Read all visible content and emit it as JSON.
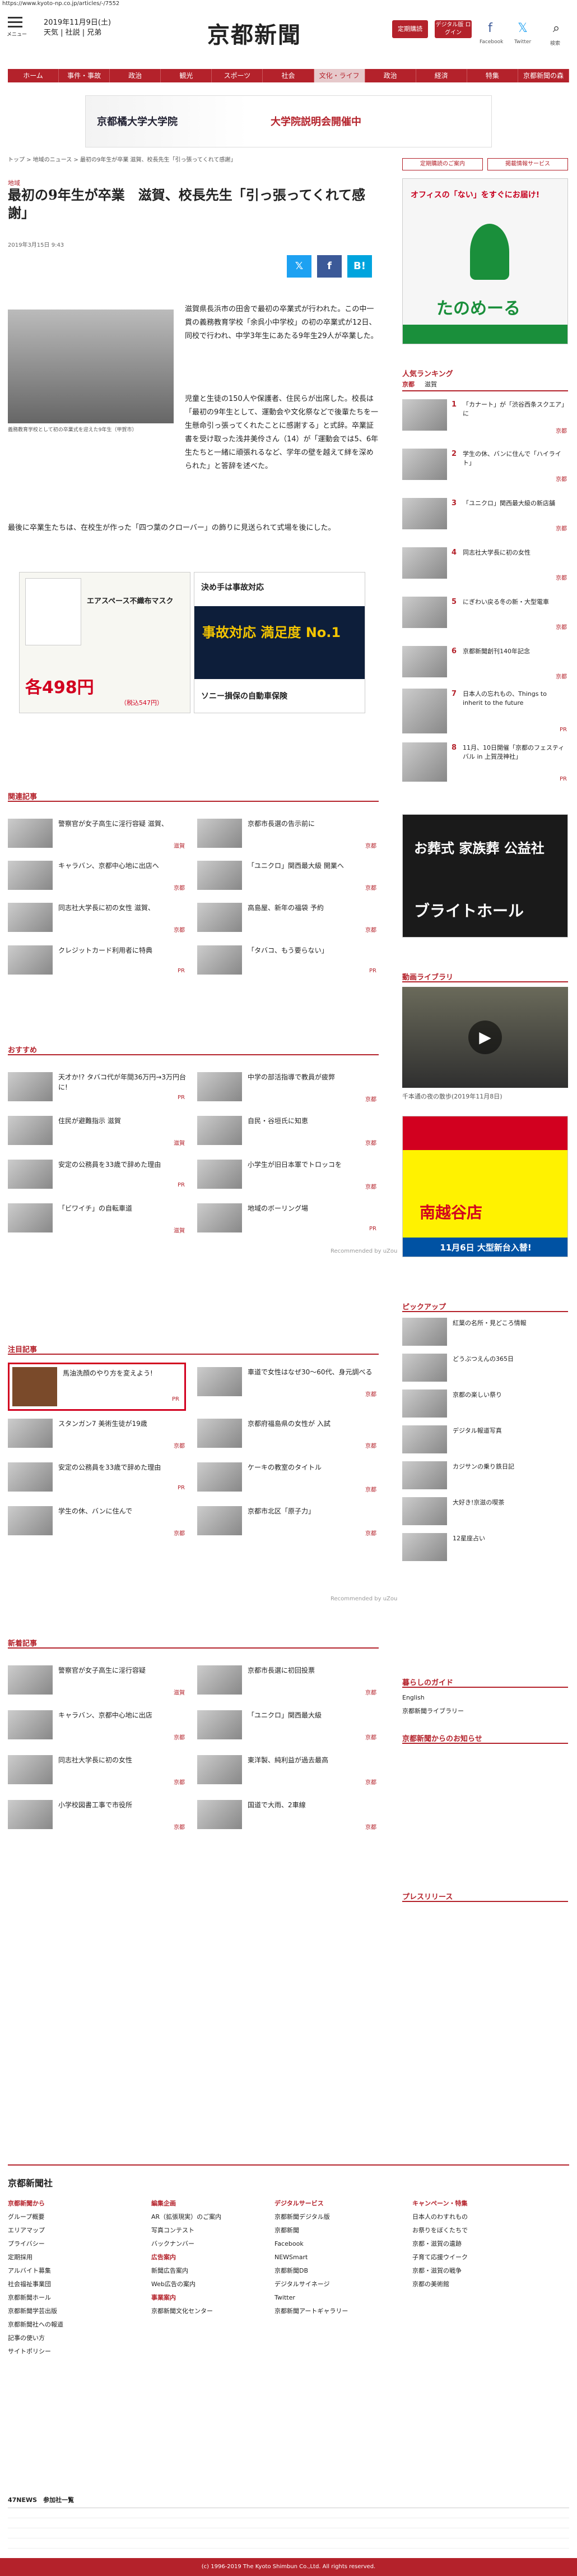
{
  "url": "https://www.kyoto-np.co.jp/articles/-/7552",
  "header": {
    "menu_label": "メニュー",
    "date": "2019年11月9日(土)",
    "weather_line": "天気 | 社説 | 兄弟",
    "logo": "京都新聞",
    "btn_subscribe": "定期購読",
    "btn_digital": "デジタル版 ログイン",
    "facebook": "Facebook",
    "twitter": "Twitter",
    "search": "検索"
  },
  "nav": [
    "ホーム",
    "事件・事故",
    "政治",
    "観光",
    "スポーツ",
    "社会",
    "文化・ライフ",
    "政治",
    "経済",
    "特集",
    "京都新聞の森"
  ],
  "banner": {
    "left": "京都橘大学大学院",
    "right": "大学院説明会開催中"
  },
  "breadcrumb": "トップ > 地域のニュース > 最初の9年生が卒業 滋賀、校長先生「引っ張ってくれて感謝」",
  "article": {
    "tag": "地域",
    "title": "最初の9年生が卒業　滋賀、校長先生「引っ張ってくれて感謝」",
    "date": "2019年3月15日 9:43",
    "photo_caption": "義務教育学校として初の卒業式を迎えた9年生（甲賀市）",
    "p1": "滋賀県長浜市の田舎で最初の卒業式が行われた。この中一貫の義務教育学校「余呉小中学校」の初の卒業式が12日、同校で行われ、中学3年生にあたる9年生29人が卒業した。",
    "p2": "児童と生徒の150人や保護者、住民らが出席した。校長は「最初の9年生として、運動会や文化祭などで後輩たちを一生懸命引っ張ってくれたことに感謝する」と式辞。卒業証書を受け取った浅井美伶さん（14）が「運動会では5、6年生たちと一緒に頑張れるなど、学年の壁を越えて絆を深められた」と答辞を述べた。",
    "p3": "最後に卒業生たちは、在校生が作った「四つ葉のクローバー」の飾りに見送られて式場を後にした。"
  },
  "ads": {
    "mask_label": "エアスペース不織布マスク",
    "mask_price": "各498円",
    "mask_sub": "（税込547円）",
    "sony_head": "決め手は事故対応",
    "sony_mid": "事故対応 満足度 No.1",
    "sony_foot": "ソニー損保の自動車保険",
    "tanomeru": "たのめーる",
    "tanomeru_sub": "オフィスの「ない」をすぐにお届け!",
    "okyatsu": "お葬式 家族葬 公益社",
    "okyatsu_sub": "ブライトホール",
    "nanto": "南越谷店",
    "nanto_sub": "11月6日 大型新台入替!"
  },
  "related": {
    "heading": "関連記事",
    "items": [
      {
        "text": "警察官が女子高生に淫行容疑 滋賀、",
        "pref": "滋賀"
      },
      {
        "text": "キャラバン、京都中心地に出店へ",
        "pref": "京都"
      },
      {
        "text": "同志社大学長に初の女性 滋賀、",
        "pref": "京都"
      },
      {
        "text": "クレジットカード利用者に特典",
        "pref": "PR"
      },
      {
        "text": "京都市長選の告示前に",
        "pref": "京都"
      },
      {
        "text": "「ユニクロ」関西最大級 開業へ",
        "pref": "京都"
      },
      {
        "text": "高島屋、新年の福袋 予約",
        "pref": "京都"
      },
      {
        "text": "「タバコ、もう要らない」",
        "pref": "PR"
      }
    ]
  },
  "recommend": {
    "heading": "おすすめ",
    "items": [
      {
        "text": "天才か!? タバコ代が年間36万円→3万円台に!",
        "pref": "PR"
      },
      {
        "text": "中学の部活指導で教員が疲弊",
        "pref": "京都"
      },
      {
        "text": "住民が避難指示 滋賀",
        "pref": "滋賀"
      },
      {
        "text": "自民・谷垣氏に知恵",
        "pref": "京都"
      },
      {
        "text": "安定の公務員を33歳で辞めた理由",
        "pref": "PR"
      },
      {
        "text": "小学生が旧日本軍でトロッコを",
        "pref": "京都"
      },
      {
        "text": "「ビワイチ」の自転車道",
        "pref": "滋賀"
      },
      {
        "text": "地域のボーリング場",
        "pref": "PR"
      }
    ]
  },
  "attention": {
    "heading": "注目記事",
    "items": [
      {
        "text": "馬油洗顔のやり方を変えよう!",
        "pref": "PR"
      },
      {
        "text": "車道で女性はなぜ30〜60代、身元調べる",
        "pref": "京都"
      },
      {
        "text": "スタンガン7 美術生徒が19歳",
        "pref": "京都"
      },
      {
        "text": "京都府福島県の女性が 入試",
        "pref": "京都"
      },
      {
        "text": "安定の公務員を33歳で辞めた理由",
        "pref": "PR"
      },
      {
        "text": "ケーキの教室のタイトル",
        "pref": "京都"
      },
      {
        "text": "学生の休、バンに住んで",
        "pref": "京都"
      },
      {
        "text": "京都市北区「原子力」",
        "pref": "京都"
      }
    ]
  },
  "newest": {
    "heading": "新着記事",
    "items": [
      {
        "text": "警察官が女子高生に淫行容疑",
        "pref": "滋賀"
      },
      {
        "text": "京都市長選に初回投票",
        "pref": "京都"
      },
      {
        "text": "キャラバン、京都中心地に出店",
        "pref": "京都"
      },
      {
        "text": "「ユニクロ」関西最大級",
        "pref": "京都"
      },
      {
        "text": "同志社大学長に初の女性",
        "pref": "京都"
      },
      {
        "text": "東洋製、純利益が過去最高",
        "pref": "京都"
      },
      {
        "text": "小学校図書工事で市役所",
        "pref": "京都"
      },
      {
        "text": "国道で大雨、2車線",
        "pref": "京都"
      }
    ]
  },
  "sidebar": {
    "btn1": "定期購読のご案内",
    "btn2": "掲載情報サービス",
    "ranking_title": "人気ランキング",
    "ranking_tabs": [
      "京都",
      "滋賀"
    ],
    "ranking": [
      {
        "rank": "1",
        "text": "「カナート」が「渋谷西条スクエア」に",
        "pref": "京都"
      },
      {
        "rank": "2",
        "text": "学生の休、バンに住んで「ハイライト」",
        "pref": "京都"
      },
      {
        "rank": "3",
        "text": "「ユニクロ」関西最大級の新店舗",
        "pref": "京都"
      },
      {
        "rank": "4",
        "text": "同志社大学長に初の女性",
        "pref": "京都"
      },
      {
        "rank": "5",
        "text": "にぎわい戻る冬の新・大型電車",
        "pref": "京都"
      },
      {
        "rank": "6",
        "text": "京都新聞創刊140年記念",
        "pref": "京都"
      },
      {
        "rank": "7",
        "text": "日本人の忘れもの、Things to inherit to the future",
        "pref": "PR"
      },
      {
        "rank": "8",
        "text": "11月、10日開催「京都のフェスティバル in 上賀茂神社」",
        "pref": "PR"
      }
    ],
    "video_title": "動画ライブラリ",
    "video_caption": "千本通の夜の散歩(2019年11月8日)",
    "pickup_title": "ピックアップ",
    "pickup": [
      "紅葉の名所・見どころ情報",
      "どうぶつえんの365日",
      "京都の楽しい祭り",
      "デジタル報道写真",
      "カジサンの乗り鉄日記",
      "大好き!京滋の喫茶",
      "12星座占い"
    ],
    "kurashi_title": "暮らしのガイド",
    "kurashi": [
      "English",
      "京都新聞ライブラリー"
    ],
    "oshirase_title": "京都新聞からのお知らせ",
    "press_title": "プレスリリース"
  },
  "footer": {
    "logo": "京都新聞社",
    "col1_h": "京都新聞から",
    "col1": [
      "グループ概要",
      "エリアマップ",
      "プライバシー",
      "定期採用",
      "アルバイト募集",
      "社会福祉事業団",
      "京都新聞ホール",
      "京都新聞学芸出版",
      "京都新聞社への報道",
      "記事の使い方",
      "サイトポリシー"
    ],
    "col2_h": "編集企画",
    "col2": [
      "AR（拡張現実）のご案内",
      "写真コンテスト",
      "バックナンバー",
      "広告案内",
      "新聞広告案内",
      "Web広告の案内",
      "事業案内",
      "京都新聞文化センター"
    ],
    "col3_h": "デジタルサービス",
    "col3": [
      "京都新聞デジタル版",
      "京都新聞",
      "Facebook",
      "NEWSmart",
      "京都新聞DB",
      "デジタルサイネージ",
      "Twitter",
      "京都新聞アートギャラリー"
    ],
    "col4_h": "キャンペーン・特集",
    "col4": [
      "日本人のわすれもの",
      "お祭りをぼくたちで",
      "京都・滋賀の遺跡",
      "子育て応援ウイーク",
      "京都・滋賀の戦争",
      "京都の美術館"
    ],
    "affiliates_h": "47NEWS　参加社一覧",
    "copyright": "(c) 1996-2019 The Kyoto Shimbun Co.,Ltd. All rights reserved."
  }
}
